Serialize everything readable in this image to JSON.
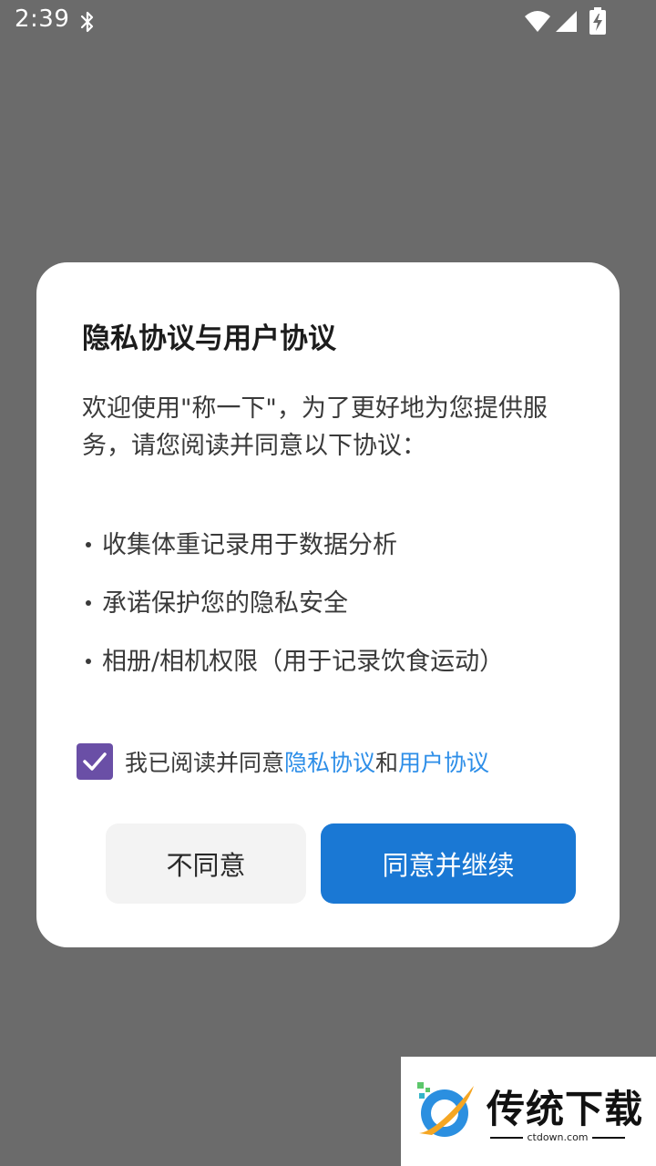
{
  "status_bar": {
    "time": "2:39",
    "icons": [
      "bluetooth-icon",
      "wifi-icon",
      "signal-icon",
      "battery-charging-icon"
    ]
  },
  "dialog": {
    "title": "隐私协议与用户协议",
    "intro": "欢迎使用\"称一下\"，为了更好地为您提供服务，请您阅读并同意以下协议：",
    "bullets": [
      "收集体重记录用于数据分析",
      "承诺保护您的隐私安全",
      "相册/相机权限（用于记录饮食运动）"
    ],
    "consent": {
      "checked": true,
      "prefix": "我已阅读并同意",
      "privacy_link": "隐私协议",
      "conjunction": "和",
      "user_link": "用户协议"
    },
    "buttons": {
      "disagree": "不同意",
      "agree": "同意并继续"
    }
  },
  "watermark": {
    "title": "传统下载",
    "subtitle": "ctdown.com"
  },
  "colors": {
    "overlay": "#6b6b6b",
    "primary": "#1a78d4",
    "link": "#2d8ee8",
    "checkbox": "#6a4fa6"
  }
}
